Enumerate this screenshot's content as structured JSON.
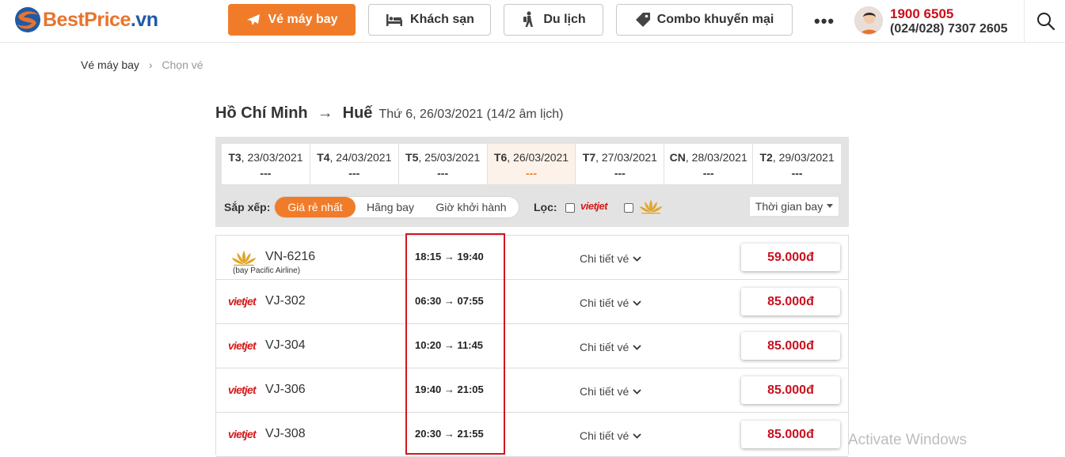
{
  "header": {
    "logo_text": "BestPrice",
    "logo_suffix": ".vn",
    "nav": [
      {
        "label": "Vé máy bay",
        "icon": "plane-icon",
        "active": true
      },
      {
        "label": "Khách sạn",
        "icon": "bed-icon",
        "active": false
      },
      {
        "label": "Du lịch",
        "icon": "traveler-icon",
        "active": false
      },
      {
        "label": "Combo khuyến mại",
        "icon": "tag-icon",
        "active": false
      }
    ],
    "more": "•••",
    "hotline": "1900 6505",
    "phone": "(024/028) 7307 2605"
  },
  "breadcrumb": {
    "home": "Vé máy bay",
    "separator": "›",
    "current": "Chọn vé"
  },
  "route": {
    "from": "Hồ Chí Minh",
    "arrow": "→",
    "to": "Huế",
    "date": "Thứ 6, 26/03/2021 (14/2 âm lịch)"
  },
  "dates": [
    {
      "day": "T3",
      "date": ", 23/03/2021",
      "price": "---",
      "selected": false
    },
    {
      "day": "T4",
      "date": ", 24/03/2021",
      "price": "---",
      "selected": false
    },
    {
      "day": "T5",
      "date": ", 25/03/2021",
      "price": "---",
      "selected": false
    },
    {
      "day": "T6",
      "date": ", 26/03/2021",
      "price": "---",
      "selected": true
    },
    {
      "day": "T7",
      "date": ", 27/03/2021",
      "price": "---",
      "selected": false
    },
    {
      "day": "CN",
      "date": ", 28/03/2021",
      "price": "---",
      "selected": false
    },
    {
      "day": "T2",
      "date": ", 29/03/2021",
      "price": "---",
      "selected": false
    }
  ],
  "sort": {
    "label": "Sắp xếp:",
    "options": [
      "Giá rẻ nhất",
      "Hãng bay",
      "Giờ khởi hành"
    ],
    "active_index": 0
  },
  "filter": {
    "label": "Lọc:",
    "vietjet_text": "vietjet",
    "time_dropdown": "Thời gian bay"
  },
  "flights": [
    {
      "airline": "vietnam-airlines",
      "flight_no": "VN-6216",
      "note": "(bay Pacific Airline)",
      "depart": "18:15",
      "arrive": "19:40",
      "detail": "Chi tiết vé",
      "price": "59.000đ"
    },
    {
      "airline": "vietjet",
      "flight_no": "VJ-302",
      "note": "",
      "depart": "06:30",
      "arrive": "07:55",
      "detail": "Chi tiết vé",
      "price": "85.000đ"
    },
    {
      "airline": "vietjet",
      "flight_no": "VJ-304",
      "note": "",
      "depart": "10:20",
      "arrive": "11:45",
      "detail": "Chi tiết vé",
      "price": "85.000đ"
    },
    {
      "airline": "vietjet",
      "flight_no": "VJ-306",
      "note": "",
      "depart": "19:40",
      "arrive": "21:05",
      "detail": "Chi tiết vé",
      "price": "85.000đ"
    },
    {
      "airline": "vietjet",
      "flight_no": "VJ-308",
      "note": "",
      "depart": "20:30",
      "arrive": "21:55",
      "detail": "Chi tiết vé",
      "price": "85.000đ"
    }
  ],
  "vietjet_logo_text": "vietjet",
  "time_arrow": "→",
  "watermark": "Activate Windows",
  "colors": {
    "brand_orange": "#f07c2a",
    "price_red": "#c8101e",
    "highlight_red": "#d0161d",
    "vietjet_red": "#d41a1a",
    "vna_gold": "#e0a52a"
  }
}
